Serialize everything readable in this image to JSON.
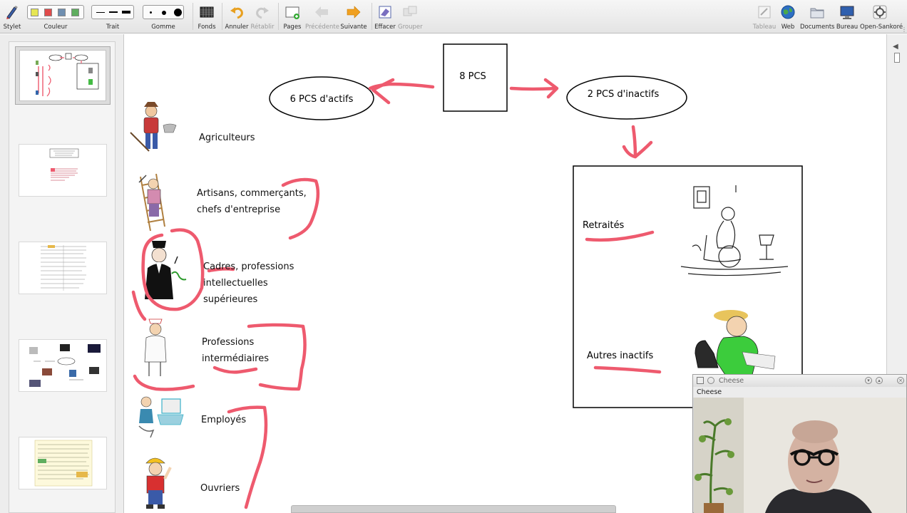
{
  "toolbar": {
    "items": [
      {
        "label": "Stylet",
        "icon": "pen-icon"
      },
      {
        "label": "Couleur",
        "icon": "color-swatches"
      },
      {
        "label": "Trait",
        "icon": "line-width-icon"
      },
      {
        "label": "Gomme",
        "icon": "eraser-size-icon"
      },
      {
        "label": "Fonds",
        "icon": "background-grid-icon"
      },
      {
        "label": "Annuler",
        "icon": "undo-icon"
      },
      {
        "label": "Rétablir",
        "icon": "redo-icon"
      },
      {
        "label": "Pages",
        "icon": "add-page-icon"
      },
      {
        "label": "Précédente",
        "icon": "previous-arrow-icon"
      },
      {
        "label": "Suivante",
        "icon": "next-arrow-icon"
      },
      {
        "label": "Effacer",
        "icon": "erase-all-icon"
      },
      {
        "label": "Grouper",
        "icon": "group-icon"
      },
      {
        "label": "Tableau",
        "icon": "board-icon"
      },
      {
        "label": "Web",
        "icon": "globe-icon"
      },
      {
        "label": "Documents",
        "icon": "folder-icon"
      },
      {
        "label": "Bureau",
        "icon": "desktop-icon"
      },
      {
        "label": "Open-Sankoré",
        "icon": "gear-icon"
      }
    ],
    "swatch_colors": [
      "#e6e653",
      "#e04b4b",
      "#6f8fb0",
      "#5fae5f"
    ]
  },
  "board": {
    "root_box": "8 PCS",
    "left_ellipse": "6 PCS d'actifs",
    "right_ellipse": "2 PCS d'inactifs",
    "categories": [
      {
        "line1": "Agriculteurs",
        "line2": "",
        "line3": ""
      },
      {
        "line1": "Artisans, commerçants,",
        "line2": "chefs d'entreprise",
        "line3": ""
      },
      {
        "line1": "Cadres, professions",
        "line2": "intellectuelles",
        "line3": "supérieures"
      },
      {
        "line1": "Professions",
        "line2": "intermédiaires",
        "line3": ""
      },
      {
        "line1": "Employés",
        "line2": "",
        "line3": ""
      },
      {
        "line1": "Ouvriers",
        "line2": "",
        "line3": ""
      }
    ],
    "inactive": {
      "retired": "Retraités",
      "others": "Autres inactifs"
    },
    "annotation_color": "#ee5a6e"
  },
  "webcam": {
    "title": "Cheese",
    "menu": "Cheese"
  }
}
